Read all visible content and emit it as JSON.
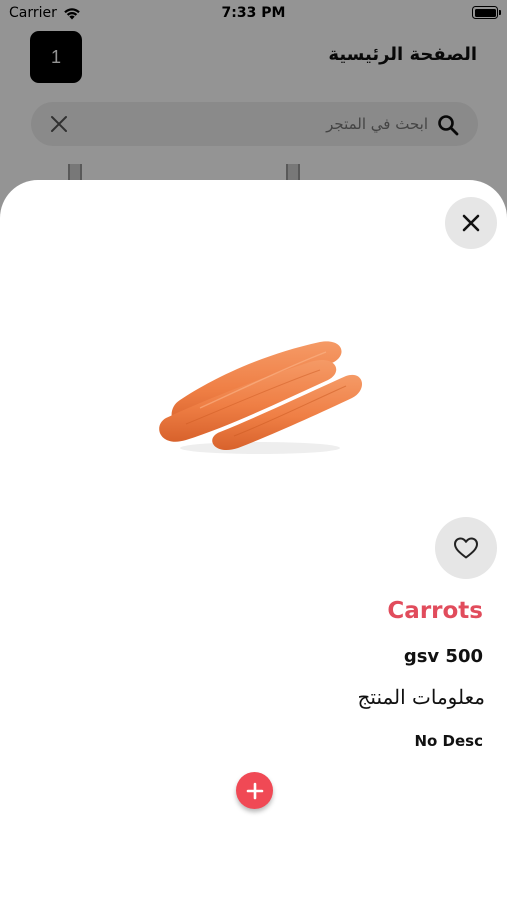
{
  "status_bar": {
    "carrier": "Carrier",
    "time": "7:33 PM",
    "battery_level": 1.0
  },
  "header": {
    "cart_count": "1",
    "title": "الصفحة الرئيسية"
  },
  "search": {
    "placeholder": "ابحث في المتجر",
    "value": "",
    "search_icon": "search-icon",
    "clear_icon": "close-icon"
  },
  "product_sheet": {
    "close_icon": "close-icon",
    "image_alt": "carrots",
    "favorite_icon": "heart-outline-icon",
    "name": "Carrots",
    "price": "gsv 500",
    "info_label": "معلومات المنتج",
    "description": "No Desc",
    "add_icon": "plus-icon"
  },
  "colors": {
    "accent_red": "#e14c5c",
    "add_button": "#f04955",
    "button_gray": "#e6e6e6",
    "overlay": "rgba(0,0,0,0.42)"
  }
}
